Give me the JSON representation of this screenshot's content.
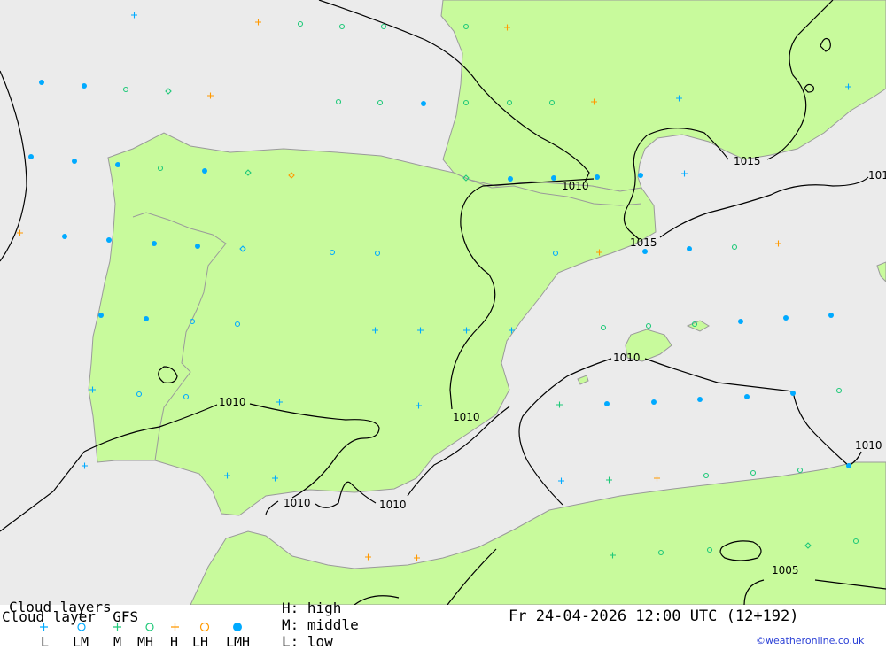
{
  "map": {
    "isobar_labels": [
      "1010",
      "1010",
      "1010",
      "1010",
      "1010",
      "1010",
      "1010",
      "1015",
      "1015",
      "1005",
      "101",
      "1010"
    ],
    "colors": {
      "sea": "#ebebeb",
      "land": "#c8fa9c",
      "coast": "#9a9a9a",
      "isobar": "#000000",
      "cyan": "#00aaff",
      "green_marker": "#1ec878",
      "orange": "#ff9900"
    }
  },
  "legend": {
    "title": "Cloud layers",
    "subtitle": "Cloud layer  GFS",
    "codes": [
      "L",
      "LM",
      "M",
      "MH",
      "H",
      "LH",
      "LMH"
    ],
    "key_high": "H: high",
    "key_middle": "M: middle",
    "key_low": "L: low",
    "datetime": "Fr 24-04-2026 12:00 UTC (12+192)",
    "credit": "©weatheronline.co.uk"
  }
}
